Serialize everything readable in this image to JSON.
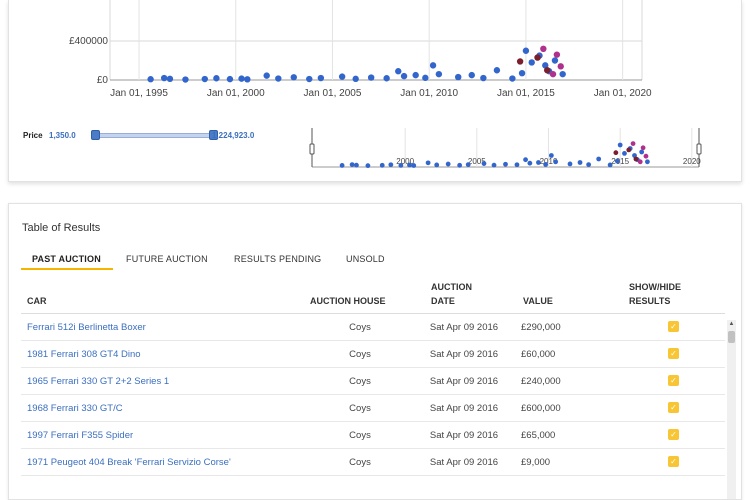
{
  "chart_data": [
    {
      "type": "scatter",
      "x_ticks": [
        "Jan 01, 1995",
        "Jan 01, 2000",
        "Jan 01, 2005",
        "Jan 01, 2010",
        "Jan 01, 2015",
        "Jan 01, 2020"
      ],
      "y_ticks": [
        "£0",
        "£400000"
      ],
      "xlim": [
        1993.5,
        2021
      ],
      "ylim": [
        0,
        400000
      ],
      "grid": true,
      "series": [
        {
          "color": "#3366cc",
          "points": [
            [
              1995.6,
              8000
            ],
            [
              1996.3,
              20000
            ],
            [
              1996.6,
              12000
            ],
            [
              1997.4,
              5000
            ],
            [
              1998.4,
              10000
            ],
            [
              1999.0,
              18000
            ],
            [
              1999.7,
              9000
            ],
            [
              2000.3,
              14000
            ],
            [
              2000.6,
              7000
            ],
            [
              2001.6,
              45000
            ],
            [
              2002.2,
              15000
            ],
            [
              2003.0,
              28000
            ],
            [
              2003.8,
              10000
            ],
            [
              2004.4,
              20000
            ],
            [
              2005.5,
              35000
            ],
            [
              2006.2,
              12000
            ],
            [
              2007.0,
              25000
            ],
            [
              2007.8,
              18000
            ],
            [
              2008.4,
              90000
            ],
            [
              2008.7,
              40000
            ],
            [
              2009.3,
              50000
            ],
            [
              2009.8,
              22000
            ],
            [
              2010.2,
              150000
            ],
            [
              2010.5,
              60000
            ],
            [
              2011.5,
              30000
            ],
            [
              2012.2,
              50000
            ],
            [
              2012.8,
              20000
            ],
            [
              2013.5,
              100000
            ],
            [
              2014.3,
              15000
            ],
            [
              2014.8,
              70000
            ],
            [
              2015.0,
              300000
            ],
            [
              2015.3,
              180000
            ],
            [
              2015.7,
              250000
            ],
            [
              2016.0,
              150000
            ],
            [
              2016.2,
              90000
            ],
            [
              2016.5,
              200000
            ],
            [
              2016.9,
              60000
            ]
          ]
        },
        {
          "color": "#7b1f2c",
          "points": [
            [
              2014.7,
              190000
            ],
            [
              2015.6,
              230000
            ],
            [
              2016.1,
              100000
            ]
          ]
        },
        {
          "color": "#b0308e",
          "points": [
            [
              2015.9,
              320000
            ],
            [
              2016.6,
              260000
            ],
            [
              2016.8,
              140000
            ],
            [
              2016.4,
              60000
            ]
          ]
        }
      ]
    },
    {
      "type": "scatter",
      "x_ticks": [
        "2000",
        "2005",
        "2010",
        "2015",
        "2020"
      ],
      "xlim": [
        1993.5,
        2020.5
      ]
    }
  ],
  "price_filter": {
    "label": "Price",
    "min": "1,350.0",
    "max": "1,224,923.0"
  },
  "table": {
    "title": "Table of Results",
    "tabs": [
      "PAST AUCTION",
      "FUTURE AUCTION",
      "RESULTS PENDING",
      "UNSOLD"
    ],
    "headers": {
      "car": "CAR",
      "auction_house": "AUCTION HOUSE",
      "auction_date_1": "AUCTION",
      "auction_date_2": "DATE",
      "value": "VALUE",
      "show_hide_1": "SHOW/HIDE",
      "show_hide_2": "RESULTS"
    },
    "rows": [
      {
        "car": "Ferrari 512i Berlinetta Boxer",
        "house": "Coys",
        "date": "Sat Apr 09 2016",
        "value": "£290,000",
        "checked": true
      },
      {
        "car": "1981 Ferrari 308 GT4 Dino",
        "house": "Coys",
        "date": "Sat Apr 09 2016",
        "value": "£60,000",
        "checked": true
      },
      {
        "car": "1965 Ferrari 330 GT 2+2 Series 1",
        "house": "Coys",
        "date": "Sat Apr 09 2016",
        "value": "£240,000",
        "checked": true
      },
      {
        "car": "1968 Ferrari 330 GT/C",
        "house": "Coys",
        "date": "Sat Apr 09 2016",
        "value": "£600,000",
        "checked": true
      },
      {
        "car": "1997 Ferrari F355 Spider",
        "house": "Coys",
        "date": "Sat Apr 09 2016",
        "value": "£65,000",
        "checked": true
      },
      {
        "car": "1971 Peugeot 404 Break 'Ferrari Servizio Corse'",
        "house": "Coys",
        "date": "Sat Apr 09 2016",
        "value": "£9,000",
        "checked": true
      }
    ]
  },
  "icons": {
    "check": "checkbox-check-icon",
    "scroll_up": "triangle-up-icon",
    "range_handle": "range-handle-icon"
  },
  "colors": {
    "accent": "#f4b400",
    "link": "#3b6fbf",
    "checkbox": "#f8c534",
    "point_blue": "#3366cc",
    "point_dark_red": "#7b1f2c",
    "point_purple": "#b0308e"
  }
}
